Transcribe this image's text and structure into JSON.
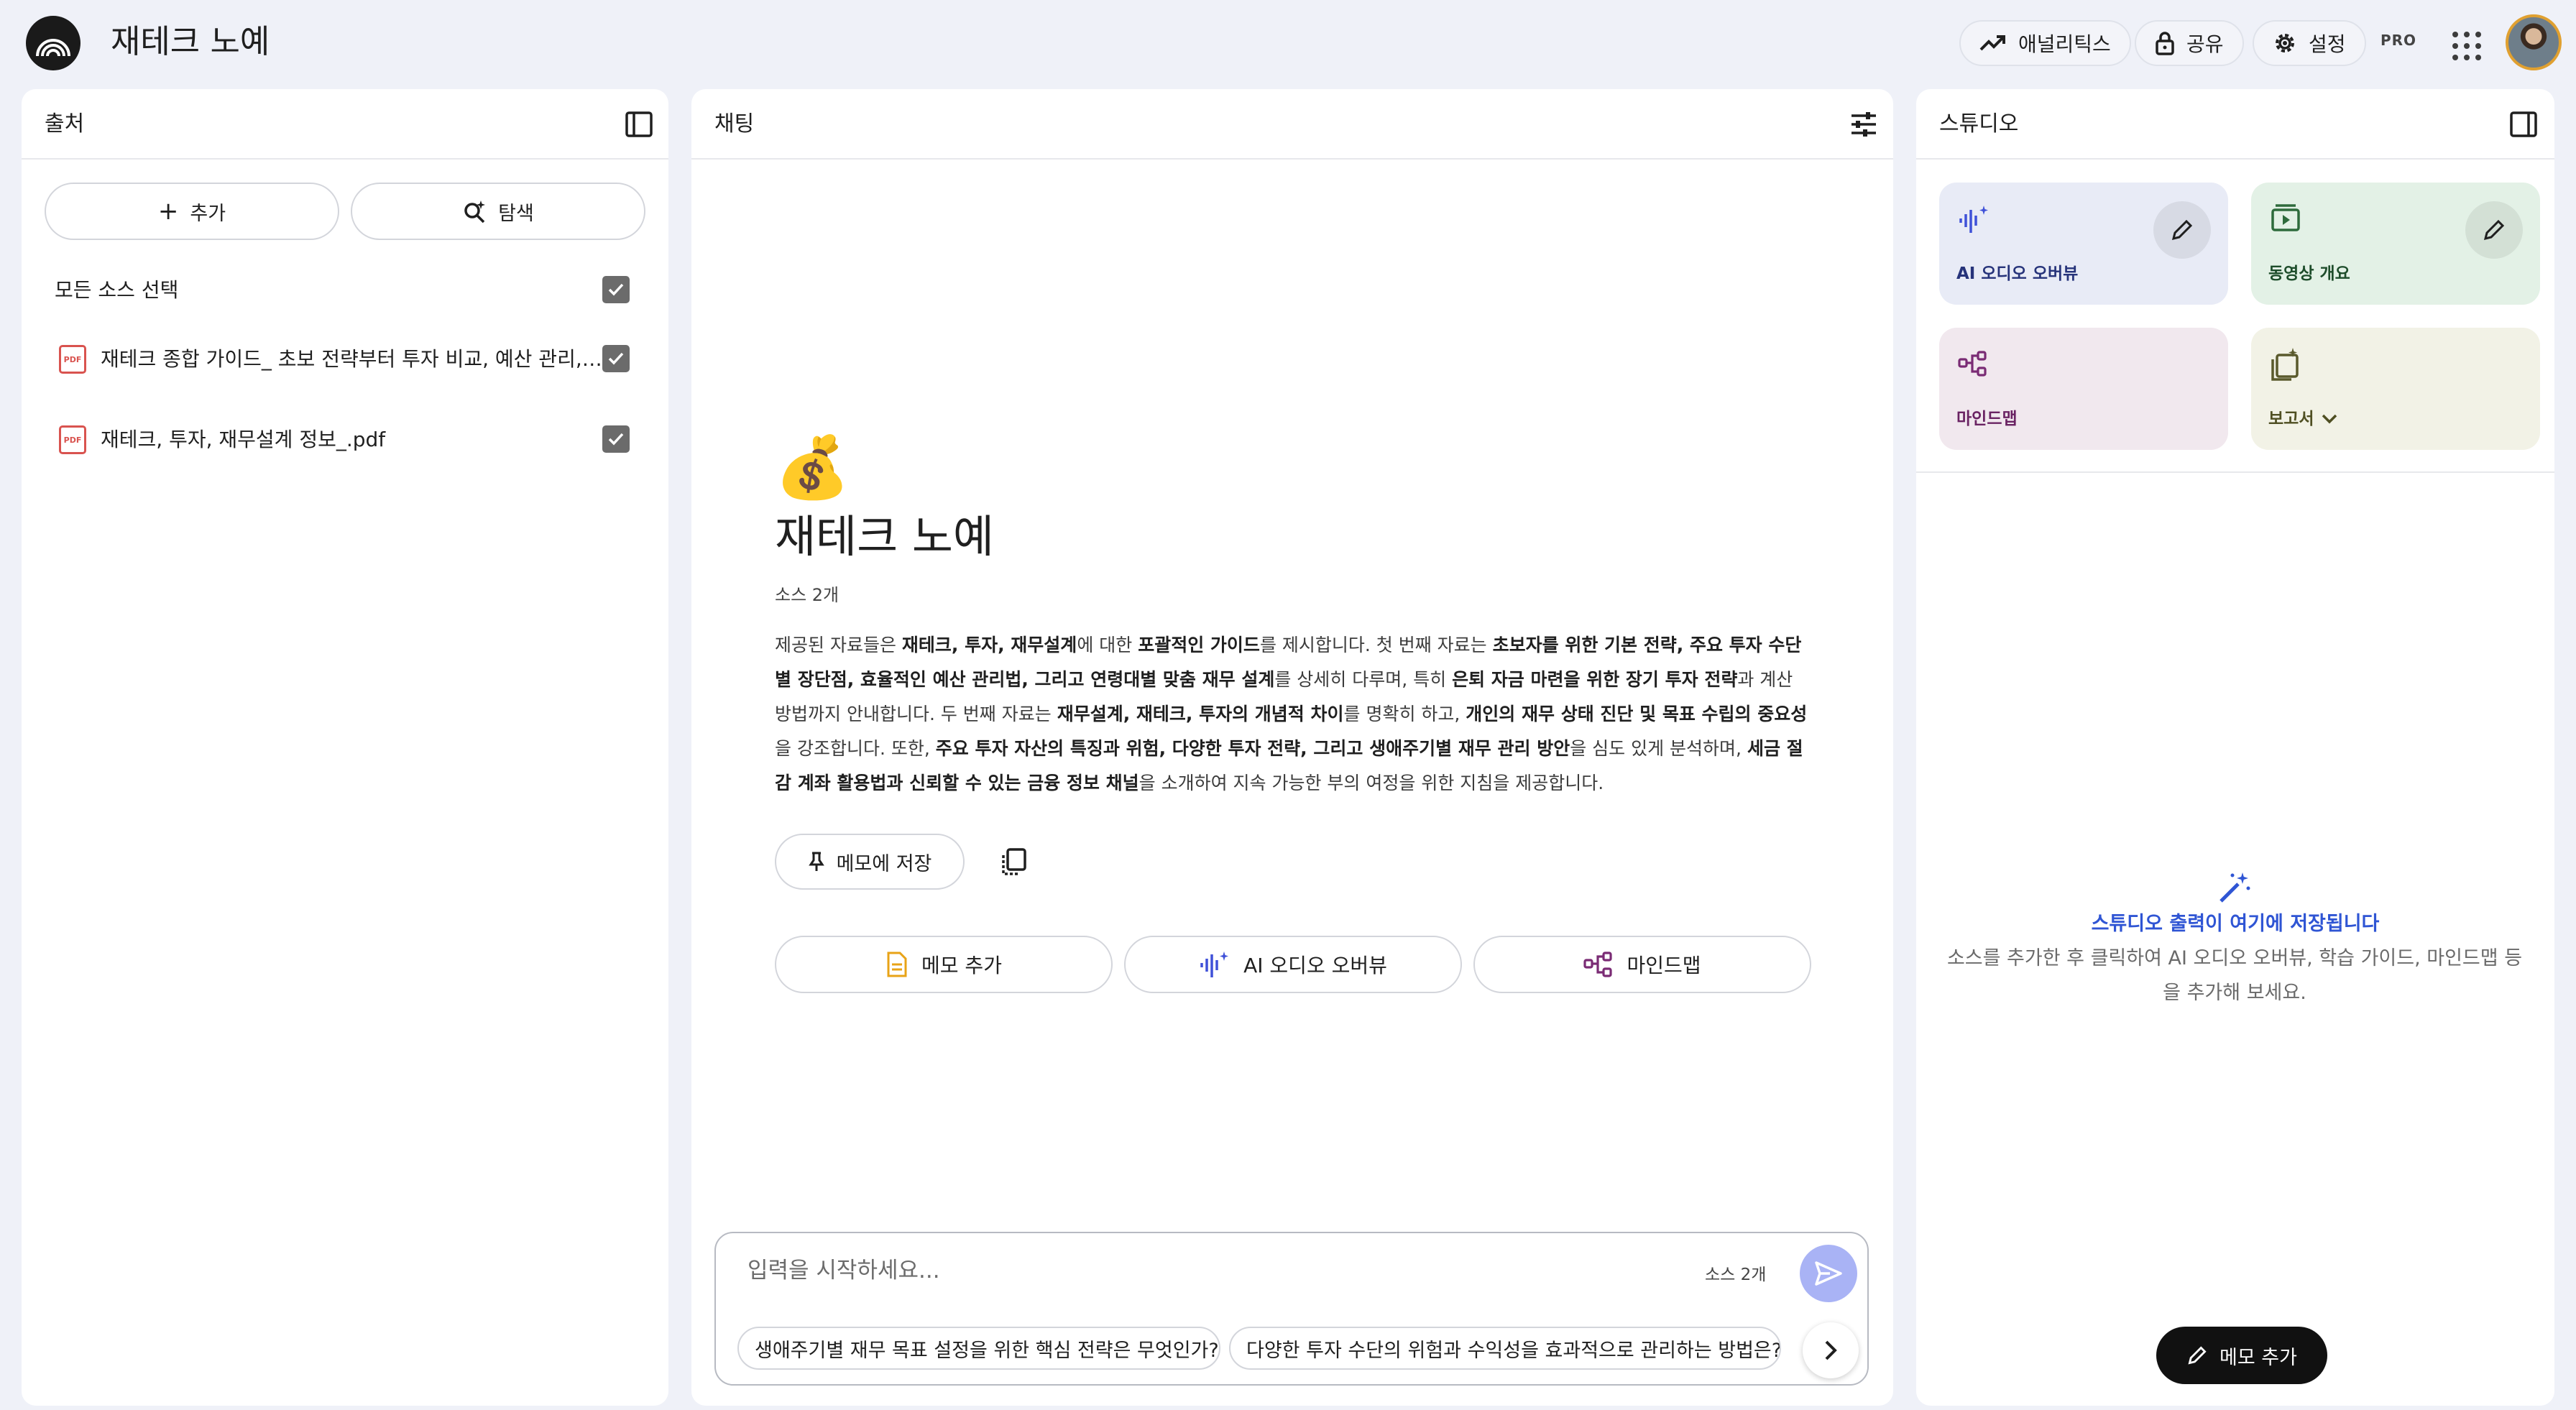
{
  "app": {
    "title": "재테크 노예",
    "logo_icon": "notebooklm-logo-icon"
  },
  "header": {
    "analytics": "애널리틱스",
    "share": "공유",
    "settings": "설정",
    "pro": "PRO"
  },
  "sources": {
    "title": "출처",
    "add": "추가",
    "discover": "탐색",
    "select_all": "모든 소스 선택",
    "items": [
      {
        "name": "재테크 종합 가이드_ 초보 전략부터 투자 비교, 예산 관리, 생애주기별 재무설계까지.pdf",
        "type": "PDF",
        "checked": true
      },
      {
        "name": "재테크, 투자, 재무설계 정보_.pdf",
        "type": "PDF",
        "checked": true
      }
    ]
  },
  "chat": {
    "title": "채팅",
    "emoji": "💰",
    "notebook_title": "재테크 노예",
    "source_count": "소스 2개",
    "summary": [
      {
        "t": "제공된 자료들은 ",
        "b": false
      },
      {
        "t": "재테크, 투자, 재무설계",
        "b": true
      },
      {
        "t": "에 대한 ",
        "b": false
      },
      {
        "t": "포괄적인 가이드",
        "b": true
      },
      {
        "t": "를 제시합니다. 첫 번째 자료는 ",
        "b": false
      },
      {
        "t": "초보자를 위한 기본 전략, 주요 투자 수단별 장단점, 효율적인 예산 관리법, 그리고 연령대별 맞춤 재무 설계",
        "b": true
      },
      {
        "t": "를 상세히 다루며, 특히 ",
        "b": false
      },
      {
        "t": "은퇴 자금 마련을 위한 장기 투자 전략",
        "b": true
      },
      {
        "t": "과 계산 방법까지 안내합니다. 두 번째 자료는 ",
        "b": false
      },
      {
        "t": "재무설계, 재테크, 투자의 개념적 차이",
        "b": true
      },
      {
        "t": "를 명확히 하고, ",
        "b": false
      },
      {
        "t": "개인의 재무 상태 진단 및 목표 수립의 중요성",
        "b": true
      },
      {
        "t": "을 강조합니다. 또한, ",
        "b": false
      },
      {
        "t": "주요 투자 자산의 특징과 위험, 다양한 투자 전략, 그리고 생애주기별 재무 관리 방안",
        "b": true
      },
      {
        "t": "을 심도 있게 분석하며, ",
        "b": false
      },
      {
        "t": "세금 절감 계좌 활용법과 신뢰할 수 있는 금융 정보 채널",
        "b": true
      },
      {
        "t": "을 소개하여 지속 가능한 부의 여정을 위한 지침을 제공합니다.",
        "b": false
      }
    ],
    "save_to_memo": "메모에 저장",
    "actions": {
      "add_memo": "메모 추가",
      "audio": "AI 오디오 오버뷰",
      "mindmap": "마인드맵"
    },
    "input_placeholder": "입력을 시작하세요...",
    "input_count": "소스 2개",
    "suggestions": [
      "생애주기별 재무 목표 설정을 위한 핵심 전략은 무엇인가?",
      "다양한 투자 수단의 위험과 수익성을 효과적으로 관리하는 방법은?"
    ]
  },
  "studio": {
    "title": "스튜디오",
    "cards": {
      "audio": "AI 오디오 오버뷰",
      "video": "동영상 개요",
      "mindmap": "마인드맵",
      "report": "보고서"
    },
    "empty_title": "스튜디오 출력이 여기에 저장됩니다",
    "empty_desc": "소스를 추가한 후 클릭하여 AI 오디오 오버뷰, 학습 가이드, 마인드맵 등을 추가해 보세요.",
    "add_memo": "메모 추가"
  },
  "colors": {
    "background": "#eff1f8",
    "audio_card": "#e8ebf6",
    "video_card": "#e3f1e6",
    "mindmap_card": "#f1e8ee",
    "report_card": "#f2f2e6",
    "accent_blue": "#2f55d4",
    "send_button": "#a9b3f5"
  }
}
